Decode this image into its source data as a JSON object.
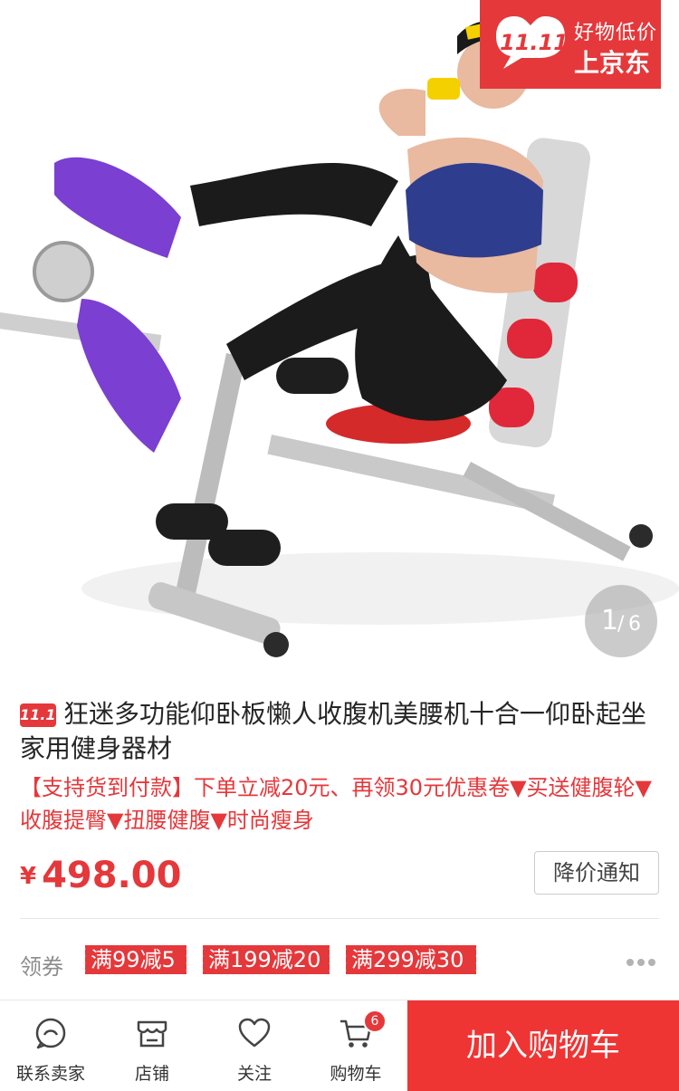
{
  "promo": {
    "bubble_text": "11.11",
    "line1": "好物低价",
    "line2": "上京东"
  },
  "gallery": {
    "current": "1",
    "separator": "/",
    "total": "6"
  },
  "product": {
    "tag": "11.11",
    "title": "狂迷多功能仰卧板懒人收腹机美腰机十合一仰卧起坐家用健身器材",
    "subtitle": "【支持货到付款】下单立减20元、再领30元优惠卷▼买送健腹轮▼收腹提臀▼扭腰健腹▼时尚瘦身",
    "currency": "¥",
    "price": "498.00",
    "notify_label": "降价通知"
  },
  "coupons": {
    "label": "领券",
    "items": [
      "满99减5",
      "满199减20",
      "满299减30"
    ]
  },
  "bottom_bar": {
    "contact_label": "联系卖家",
    "shop_label": "店铺",
    "follow_label": "关注",
    "cart_label": "购物车",
    "cart_count": "6",
    "add_to_cart_label": "加入购物车"
  },
  "colors": {
    "accent": "#e5383b",
    "button": "#ef3434",
    "muted": "#8c8c8c"
  }
}
